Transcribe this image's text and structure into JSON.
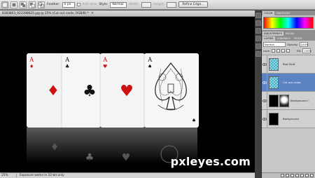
{
  "options_bar": {
    "feather_label": "Feather:",
    "feather_value": "0 px",
    "antialias_label": "Anti-alias",
    "style_label": "Style:",
    "style_value": "Normal",
    "width_label": "Width:",
    "height_label": "Height:",
    "refine_edge_label": "Refine Edge..."
  },
  "document": {
    "tab_title": "8383863_923398625.jpg @ 25% (Cut out cards, RGB/8) *",
    "close_glyph": "×",
    "zoom": "25%",
    "status_info": "Exposure works in 32-bit only"
  },
  "cards": [
    {
      "rank": "A",
      "suit": "♦",
      "color": "#cc1111"
    },
    {
      "rank": "A",
      "suit": "♣",
      "color": "#111111"
    },
    {
      "rank": "A",
      "suit": "♥",
      "color": "#cc1111"
    },
    {
      "rank": "A",
      "suit": "♠",
      "color": "#111111"
    }
  ],
  "panels": {
    "color_tabs": [
      "COLOR",
      "SWATCHES"
    ],
    "adjust_tabs": [
      "ADJUSTMENTS",
      "MASKS"
    ],
    "layer_tabs": [
      "LAYERS",
      "CHANNELS",
      "PATHS"
    ],
    "blend_mode": "Normal",
    "opacity_label": "Opacity:",
    "opacity_value": "100%",
    "lock_label": "Lock:",
    "fill_label": "Fill:",
    "fill_value": "100%",
    "layers": [
      {
        "name": "Red Stuff",
        "selected": false
      },
      {
        "name": "Cut out cards",
        "selected": true
      },
      {
        "name": "Background co...",
        "selected": false
      },
      {
        "name": "Background",
        "selected": false
      }
    ]
  },
  "watermark": "pxleyes.com",
  "colors": {
    "selection": "#5b82c2",
    "canvas": "#000000"
  }
}
